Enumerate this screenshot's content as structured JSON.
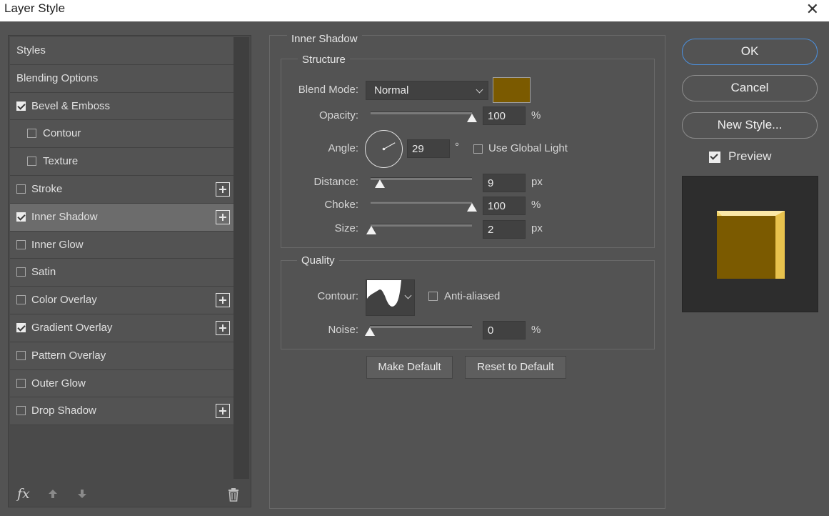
{
  "window": {
    "title": "Layer Style",
    "close_glyph": "✕"
  },
  "styles_list": [
    {
      "label": "Styles",
      "kind": "plain"
    },
    {
      "label": "Blending Options",
      "kind": "plain"
    },
    {
      "label": "Bevel & Emboss",
      "kind": "check",
      "checked": true
    },
    {
      "label": "Contour",
      "kind": "sub",
      "checked": false
    },
    {
      "label": "Texture",
      "kind": "sub",
      "checked": false
    },
    {
      "label": "Stroke",
      "kind": "check",
      "checked": false,
      "plus": true
    },
    {
      "label": "Inner Shadow",
      "kind": "check",
      "checked": true,
      "plus": true,
      "selected": true
    },
    {
      "label": "Inner Glow",
      "kind": "check",
      "checked": false
    },
    {
      "label": "Satin",
      "kind": "check",
      "checked": false
    },
    {
      "label": "Color Overlay",
      "kind": "check",
      "checked": false,
      "plus": true
    },
    {
      "label": "Gradient Overlay",
      "kind": "check",
      "checked": true,
      "plus": true
    },
    {
      "label": "Pattern Overlay",
      "kind": "check",
      "checked": false
    },
    {
      "label": "Outer Glow",
      "kind": "check",
      "checked": false
    },
    {
      "label": "Drop Shadow",
      "kind": "check",
      "checked": false,
      "plus": true
    }
  ],
  "bottom_tools": {
    "fx_label": "fx"
  },
  "inner_shadow": {
    "title": "Inner Shadow",
    "structure": {
      "title": "Structure",
      "blend_mode_label": "Blend Mode:",
      "blend_mode_value": "Normal",
      "shadow_color": "#7b5a00",
      "opacity_label": "Opacity:",
      "opacity_value": "100",
      "opacity_unit": "%",
      "opacity_fraction": 1.0,
      "angle_label": "Angle:",
      "angle_value": "29",
      "angle_unit": "°",
      "use_global_light_label": "Use Global Light",
      "use_global_light": false,
      "distance_label": "Distance:",
      "distance_value": "9",
      "distance_unit": "px",
      "distance_fraction": 0.09,
      "choke_label": "Choke:",
      "choke_value": "100",
      "choke_unit": "%",
      "choke_fraction": 1.0,
      "size_label": "Size:",
      "size_value": "2",
      "size_unit": "px",
      "size_fraction": 0.01
    },
    "quality": {
      "title": "Quality",
      "contour_label": "Contour:",
      "anti_aliased_label": "Anti-aliased",
      "anti_aliased": false,
      "noise_label": "Noise:",
      "noise_value": "0",
      "noise_unit": "%",
      "noise_fraction": 0.0
    },
    "make_default_label": "Make Default",
    "reset_default_label": "Reset to Default"
  },
  "right_panel": {
    "ok_label": "OK",
    "cancel_label": "Cancel",
    "new_style_label": "New Style...",
    "preview_label": "Preview",
    "preview_checked": true,
    "preview_fill": "#7b5a00",
    "preview_bevel": "#f3d36a",
    "accent_color": "#4b8fdc"
  }
}
